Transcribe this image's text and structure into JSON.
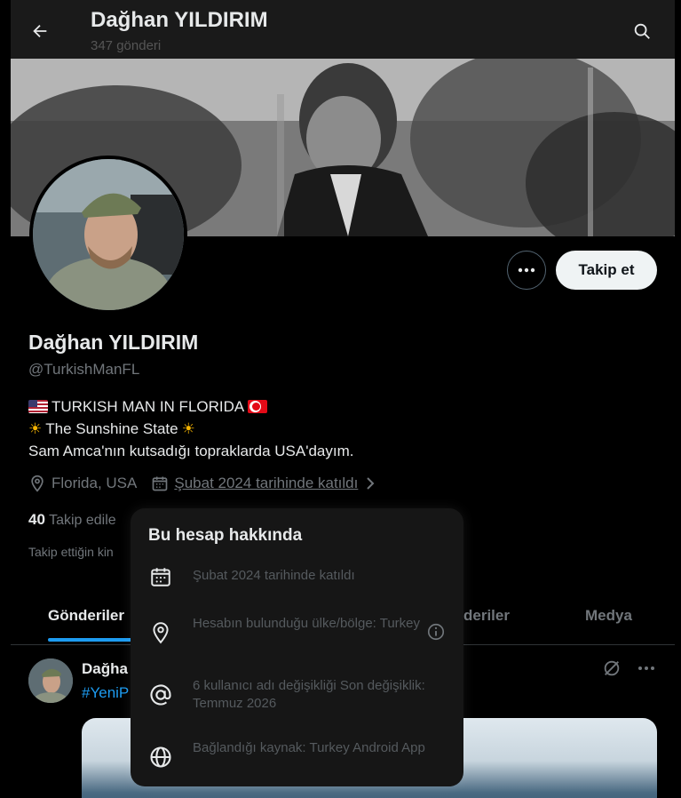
{
  "header": {
    "title": "Dağhan YILDIRIM",
    "post_count": "347 gönderi"
  },
  "actions": {
    "follow_label": "Takip et"
  },
  "profile": {
    "name": "Dağhan YILDIRIM",
    "handle": "@TurkishManFL",
    "bio": [
      "TURKISH MAN IN FLORIDA",
      "The Sunshine State",
      "Sam Amca'nın kutsadığı topraklarda USA'dayım."
    ],
    "location": "Florida, USA",
    "joined": "Şubat 2024 tarihinde katıldı",
    "following_count": "40",
    "following_label": "Takip edile",
    "followed_by": "Takip ettiğin kin"
  },
  "tabs": [
    {
      "label": "Gönderiler"
    },
    {
      "label": "deriler"
    },
    {
      "label": "Medya"
    }
  ],
  "post": {
    "author": "Dağha",
    "hashtag": "#YeniP"
  },
  "about_popup": {
    "title": "Bu hesap hakkında",
    "rows": [
      {
        "icon": "calendar-icon",
        "text": "Şubat 2024 tarihinde katıldı"
      },
      {
        "icon": "location-pin-icon",
        "text": "Hesabın bulunduğu ülke/bölge: Turkey"
      },
      {
        "icon": "at-sign-icon",
        "text": "6 kullanıcı adı değişikliği Son değişiklik: Temmuz 2026"
      },
      {
        "icon": "globe-icon",
        "text": "Bağlandığı kaynak: Turkey Android App"
      }
    ]
  },
  "colors": {
    "accent": "#1d9bf0",
    "background": "#000000",
    "popup_bg": "#161616"
  }
}
